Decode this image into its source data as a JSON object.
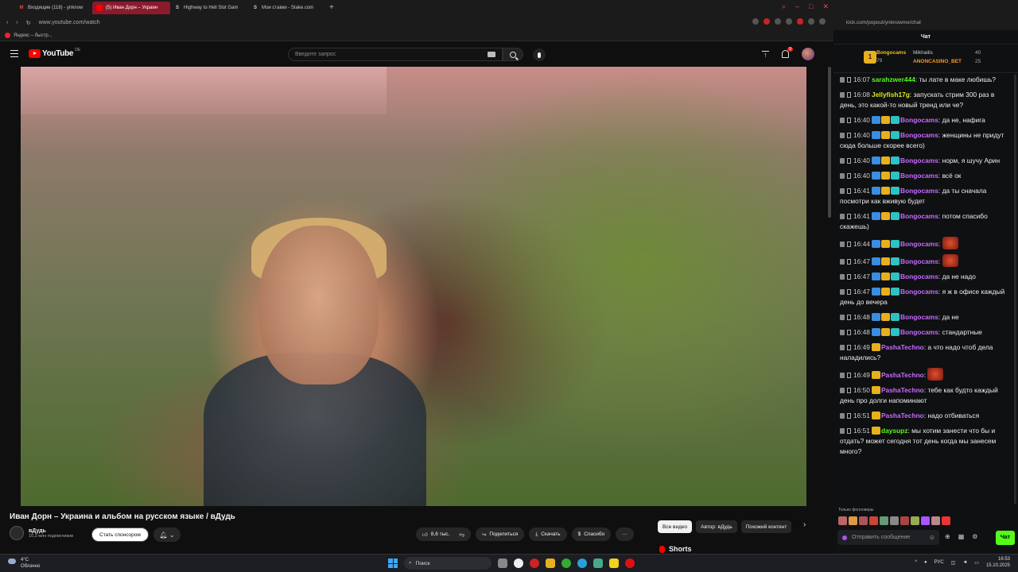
{
  "browser": {
    "tabs": [
      {
        "label": "Входящие (118) - ynknow",
        "icon": "gmail-icon",
        "color": "#ea4335"
      },
      {
        "label": "(5) Иван Дорн – Украин",
        "icon": "youtube-icon",
        "color": "#ff0000"
      },
      {
        "label": "Highway to Hell Slot Gam",
        "icon": "stake-icon",
        "color": "#ffffff"
      },
      {
        "label": "Мои ставки - Stake.com",
        "icon": "stake-icon",
        "color": "#ffffff"
      }
    ],
    "url": "www.youtube.com/watch",
    "bookmark": "Яндекс – быстр..."
  },
  "youtube": {
    "logo_text": "YouTube",
    "country_code": "DE",
    "search_placeholder": "Введите запрос",
    "notifications_count": "9",
    "video_title": "Иван Дорн – Украина и альбом на русском языке / вДудь",
    "channel_name": "вДудь",
    "subscribers": "10,3 млн подписчиков",
    "sponsor_label": "Стать спонсором",
    "likes": "8,6 тыс.",
    "share_label": "Поделиться",
    "download_label": "Скачать",
    "thanks_label": "Спасибо",
    "more_label": "···",
    "chips": [
      "Все видео",
      "Автор: вДудь",
      "Похожий контент"
    ],
    "shorts_label": "Shorts"
  },
  "chat": {
    "url": "kick.com/popout/ynknowme/chat",
    "title": "Чат",
    "pinned": {
      "top_name": "Bongocams",
      "top_value": "79",
      "second_name": "Mikhailis",
      "second_value": "40",
      "third_name": "ANONCASINO_BET",
      "third_value": "25"
    },
    "messages": [
      {
        "time": "16:07",
        "user": "sarahzwer444",
        "color": "#53fc18",
        "badges": 0,
        "text": "ты лате в макe любишь?"
      },
      {
        "time": "16:08",
        "user": "Jellyfish17g",
        "color": "#d8e81c",
        "badges": 0,
        "text": "запускать стрим 300 раз в день, это какой-то новый тренд или че?"
      },
      {
        "time": "16:40",
        "user": "Bongocams",
        "color": "#c66bff",
        "badges": 3,
        "text": "да не, нафига"
      },
      {
        "time": "16:40",
        "user": "Bongocams",
        "color": "#c66bff",
        "badges": 3,
        "text": "женщины не придут сюда больше скорее всего)"
      },
      {
        "time": "16:40",
        "user": "Bongocams",
        "color": "#c66bff",
        "badges": 3,
        "text": "норм, я шучу Арин"
      },
      {
        "time": "16:40",
        "user": "Bongocams",
        "color": "#c66bff",
        "badges": 3,
        "text": "всё ок"
      },
      {
        "time": "16:41",
        "user": "Bongocams",
        "color": "#c66bff",
        "badges": 3,
        "text": "да ты сначала посмотри как вживую будет"
      },
      {
        "time": "16:41",
        "user": "Bongocams",
        "color": "#c66bff",
        "badges": 3,
        "text": "потом спасибо скажешь)"
      },
      {
        "time": "16:44",
        "user": "Bongocams",
        "color": "#c66bff",
        "badges": 3,
        "text": "",
        "emote": true
      },
      {
        "time": "16:47",
        "user": "Bongocams",
        "color": "#c66bff",
        "badges": 3,
        "text": "",
        "emote": true
      },
      {
        "time": "16:47",
        "user": "Bongocams",
        "color": "#c66bff",
        "badges": 3,
        "text": "да не надо"
      },
      {
        "time": "16:47",
        "user": "Bongocams",
        "color": "#c66bff",
        "badges": 3,
        "text": "я ж в офисе каждый день до вечера"
      },
      {
        "time": "16:48",
        "user": "Bongocams",
        "color": "#c66bff",
        "badges": 3,
        "text": "да не"
      },
      {
        "time": "16:48",
        "user": "Bongocams",
        "color": "#c66bff",
        "badges": 3,
        "text": "стандартные"
      },
      {
        "time": "16:49",
        "user": "PashaTechno",
        "color": "#c66bff",
        "badges": 1,
        "text": "а что надо чтоб дела наладились?"
      },
      {
        "time": "16:49",
        "user": "PashaTechno",
        "color": "#c66bff",
        "badges": 1,
        "text": "",
        "emote": true
      },
      {
        "time": "16:50",
        "user": "PashaTechno",
        "color": "#c66bff",
        "badges": 1,
        "text": "тебе как будто каждый день про долги напоминают"
      },
      {
        "time": "16:51",
        "user": "PashaTechno",
        "color": "#c66bff",
        "badges": 1,
        "text": "надо отбиваться"
      },
      {
        "time": "16:51",
        "user": "daysupz",
        "color": "#53fc18",
        "badges": 1,
        "text": "мы хотим занести что бы и отдать? может сегодня тот день когда мы занесем много?"
      }
    ],
    "followers_only": "Только фолловеры",
    "input_placeholder": "Отправить сообщение",
    "send_label": "Чат"
  },
  "taskbar": {
    "temp": "4°C",
    "weather": "Облачно",
    "search": "Поиск",
    "lang": "РУС",
    "time": "16:53",
    "date": "15.10.2025"
  }
}
